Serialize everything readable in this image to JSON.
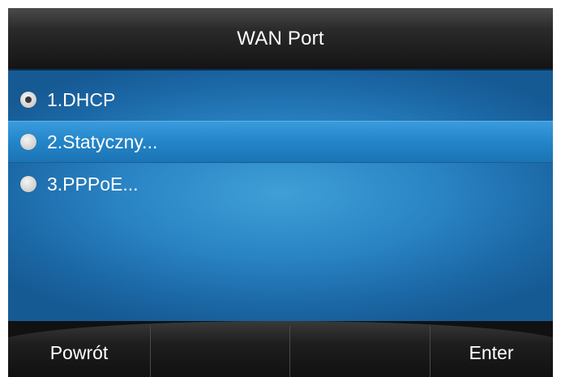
{
  "title": "WAN Port",
  "menu": {
    "items": [
      {
        "label": "1.DHCP",
        "checked": true,
        "highlighted": false
      },
      {
        "label": "2.Statyczny...",
        "checked": false,
        "highlighted": true
      },
      {
        "label": "3.PPPoE...",
        "checked": false,
        "highlighted": false
      }
    ]
  },
  "softkeys": {
    "key1": "Powrót",
    "key2": "",
    "key3": "",
    "key4": "Enter"
  },
  "colors": {
    "accent_blue": "#2a84c4",
    "highlight_blue": "#2385c9",
    "title_bar": "#1e1e1e",
    "text": "#ffffff"
  }
}
